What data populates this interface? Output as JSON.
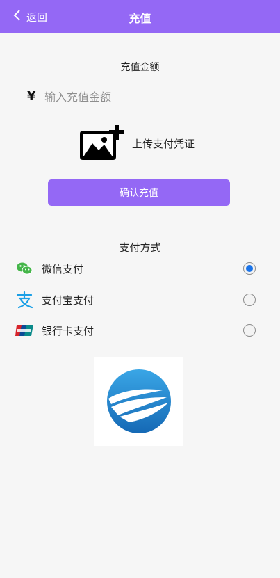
{
  "header": {
    "back_label": "返回",
    "title": "充值"
  },
  "amount": {
    "label": "充值金额",
    "currency_symbol": "¥",
    "placeholder": "输入充值金额"
  },
  "upload": {
    "label": "上传支付凭证",
    "icon": "add-image-icon"
  },
  "confirm_button": {
    "label": "确认充值"
  },
  "payment": {
    "title": "支付方式",
    "methods": [
      {
        "label": "微信支付",
        "icon": "wechat-icon",
        "selected": true
      },
      {
        "label": "支付宝支付",
        "icon": "alipay-icon",
        "selected": false
      },
      {
        "label": "银行卡支付",
        "icon": "unionpay-icon",
        "selected": false
      }
    ]
  },
  "colors": {
    "accent": "#9468f5",
    "radio_selected": "#1a73e8"
  }
}
